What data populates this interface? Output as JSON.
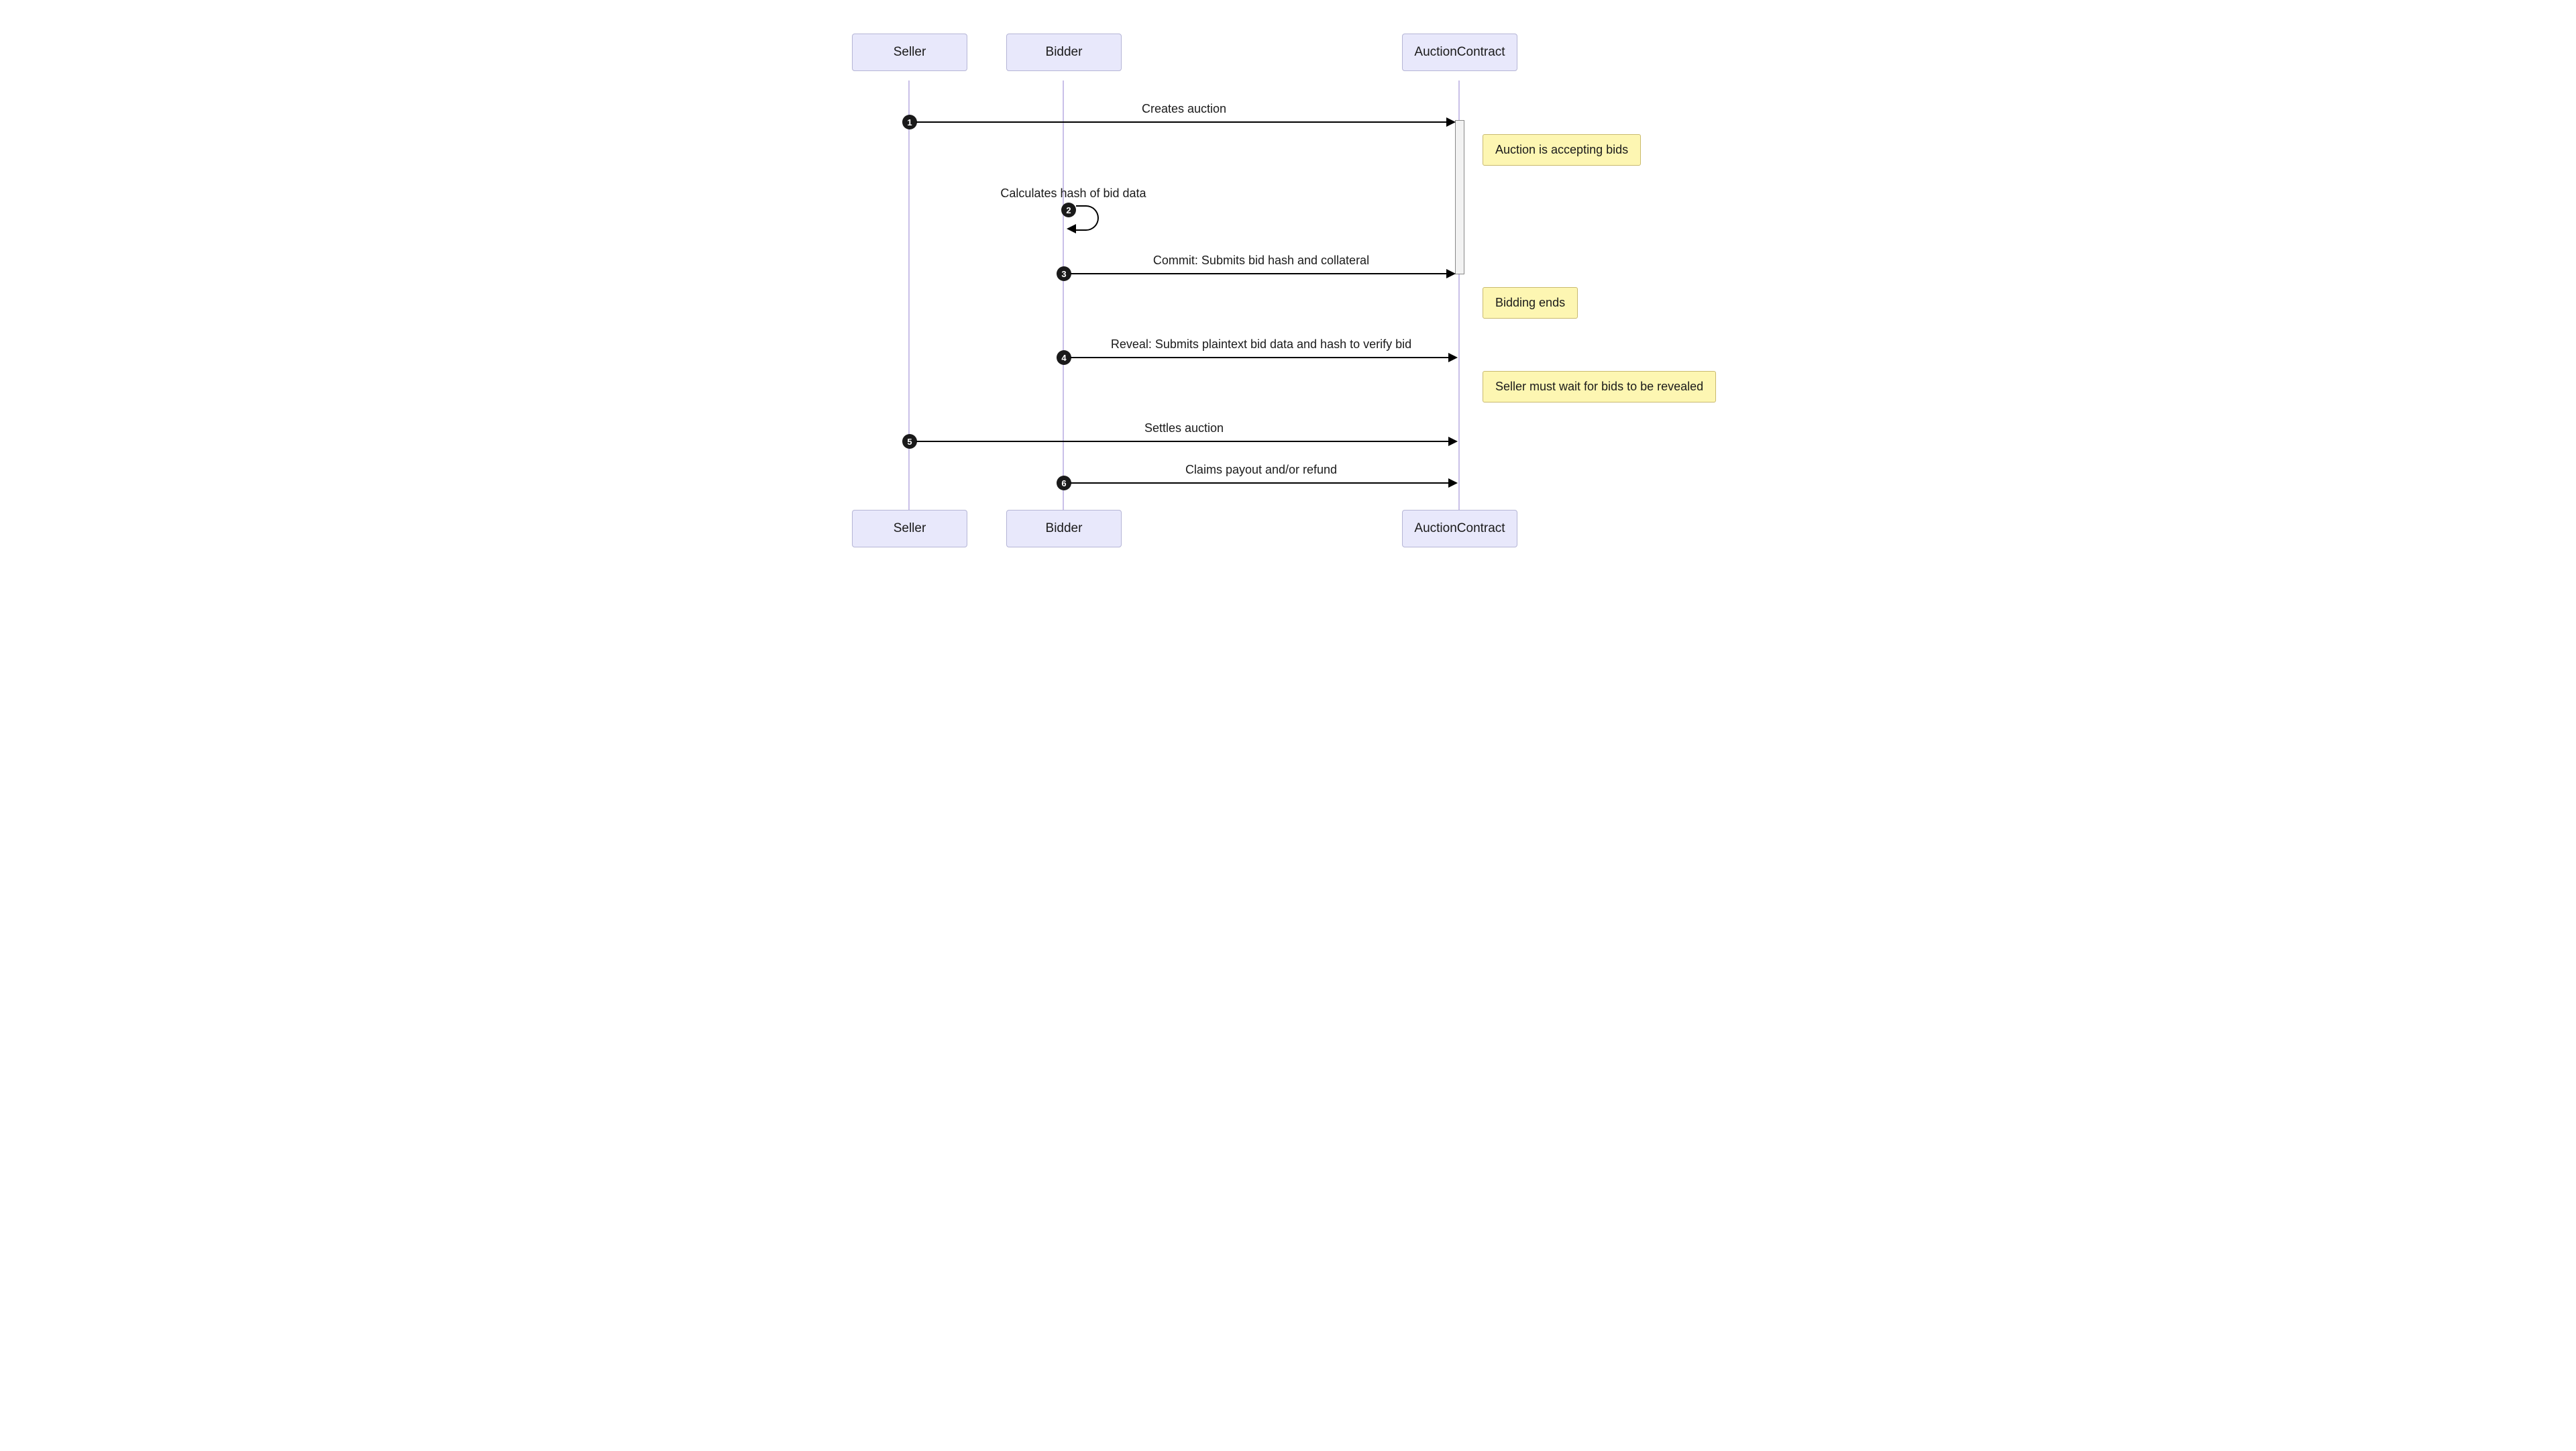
{
  "chart_data": {
    "type": "sequence",
    "participants": [
      "Seller",
      "Bidder",
      "AuctionContract"
    ],
    "messages": [
      {
        "n": 1,
        "from": "Seller",
        "to": "AuctionContract",
        "label": "Creates auction"
      },
      {
        "n": 2,
        "from": "Bidder",
        "to": "Bidder",
        "label": "Calculates hash of bid data"
      },
      {
        "n": 3,
        "from": "Bidder",
        "to": "AuctionContract",
        "label": "Commit: Submits bid hash and collateral"
      },
      {
        "n": 4,
        "from": "Bidder",
        "to": "AuctionContract",
        "label": "Reveal: Submits plaintext bid data and hash to verify bid"
      },
      {
        "n": 5,
        "from": "Seller",
        "to": "AuctionContract",
        "label": "Settles auction"
      },
      {
        "n": 6,
        "from": "Bidder",
        "to": "AuctionContract",
        "label": "Claims payout and/or refund"
      }
    ],
    "notes": [
      {
        "after_step": 1,
        "at": "AuctionContract",
        "text": "Auction is accepting bids"
      },
      {
        "after_step": 3,
        "at": "AuctionContract",
        "text": "Bidding ends"
      },
      {
        "after_step": 4,
        "at": "AuctionContract",
        "text": "Seller must wait for bids to be revealed"
      }
    ]
  },
  "actors": {
    "seller": "Seller",
    "bidder": "Bidder",
    "contract": "AuctionContract"
  },
  "steps": {
    "s1": {
      "num": "1",
      "label": "Creates auction"
    },
    "s2": {
      "num": "2",
      "label": "Calculates hash of bid data"
    },
    "s3": {
      "num": "3",
      "label": "Commit: Submits bid hash and collateral"
    },
    "s4": {
      "num": "4",
      "label": "Reveal: Submits plaintext bid data and hash to verify bid"
    },
    "s5": {
      "num": "5",
      "label": "Settles auction"
    },
    "s6": {
      "num": "6",
      "label": "Claims payout and/or refund"
    }
  },
  "notes": {
    "n1": "Auction is accepting bids",
    "n2": "Bidding ends",
    "n3": "Seller must wait for bids to be revealed"
  }
}
